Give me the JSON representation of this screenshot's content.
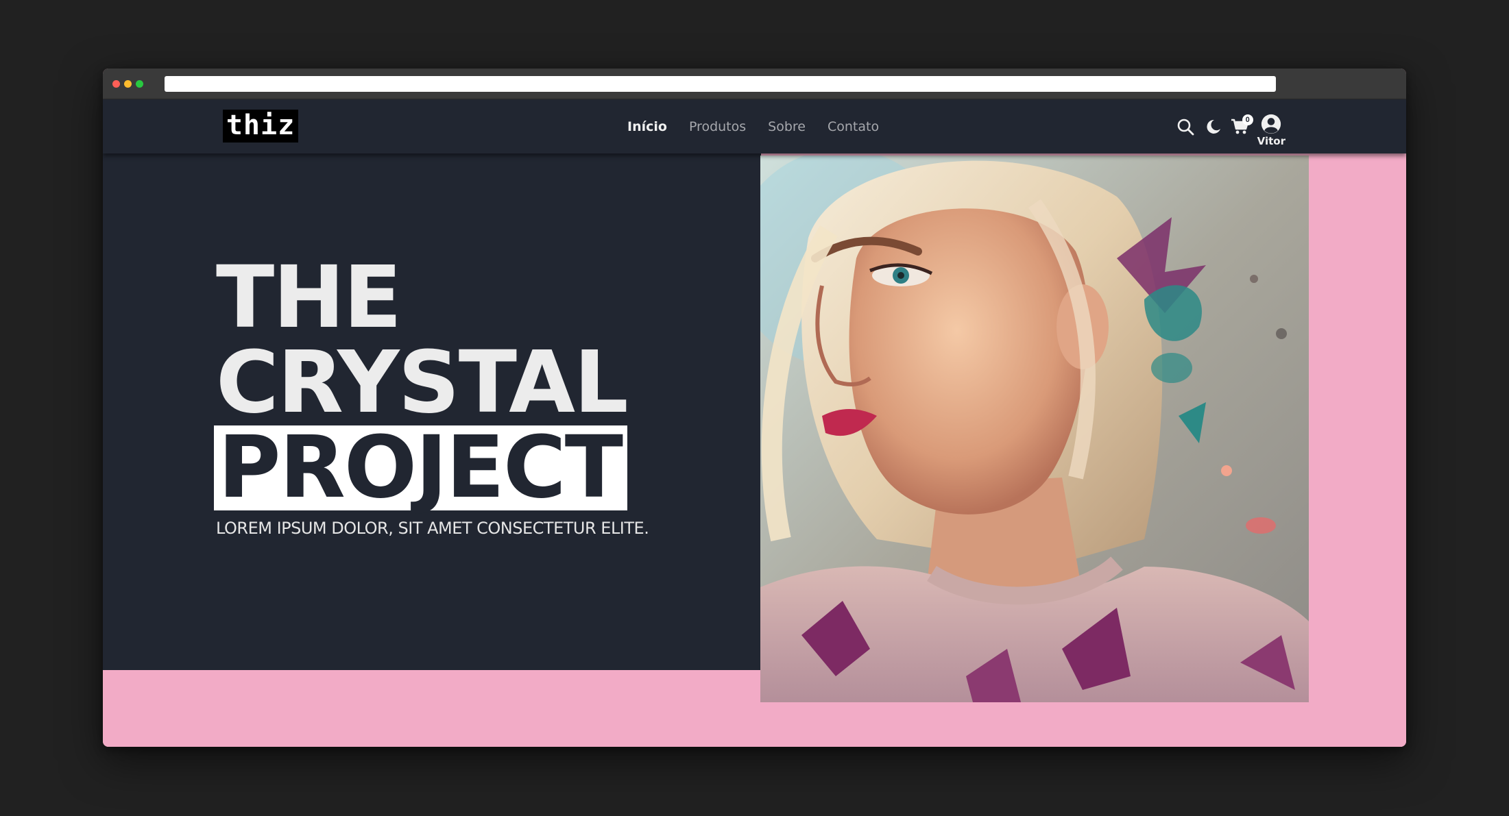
{
  "nav": {
    "logo": "thiz",
    "links": [
      {
        "label": "Início",
        "active": true
      },
      {
        "label": "Produtos",
        "active": false
      },
      {
        "label": "Sobre",
        "active": false
      },
      {
        "label": "Contato",
        "active": false
      }
    ],
    "icons": [
      "search-icon",
      "moon-icon",
      "cart-icon",
      "user-icon"
    ],
    "cart_count": "0",
    "user_name": "Vitor"
  },
  "hero": {
    "line1": "THE",
    "line2": "CRYSTAL",
    "line3": "PROJECT",
    "subtitle": "LOREM IPSUM DOLOR, SIT AMET CONSECTETUR ELITE."
  },
  "colors": {
    "background": "#212121",
    "navbar": "#212631",
    "accent_pink": "#f2abc6",
    "headline": "#ececec"
  }
}
